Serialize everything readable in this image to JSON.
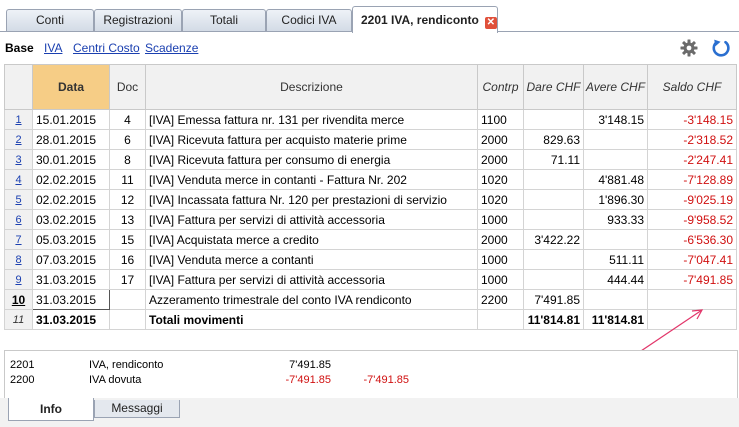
{
  "tabs": [
    {
      "label": "Conti"
    },
    {
      "label": "Registrazioni"
    },
    {
      "label": "Totali"
    },
    {
      "label": "Codici IVA"
    },
    {
      "label": "2201 IVA, rendiconto"
    }
  ],
  "views": [
    "Base",
    "IVA",
    "Centri Costo",
    "Scadenze"
  ],
  "columns": [
    "Data",
    "Doc",
    "Descrizione",
    "Contrp",
    "Dare CHF",
    "Avere CHF",
    "Saldo CHF"
  ],
  "rows": [
    {
      "n": "1",
      "date": "15.01.2015",
      "doc": "4",
      "desc": "[IVA] Emessa fattura nr. 131 per rivendita merce",
      "contrp": "1100",
      "dare": "",
      "avere": "3'148.15",
      "saldo": "-3'148.15"
    },
    {
      "n": "2",
      "date": "28.01.2015",
      "doc": "6",
      "desc": "[IVA] Ricevuta fattura per acquisto materie prime",
      "contrp": "2000",
      "dare": "829.63",
      "avere": "",
      "saldo": "-2'318.52"
    },
    {
      "n": "3",
      "date": "30.01.2015",
      "doc": "8",
      "desc": "[IVA] Ricevuta fattura per consumo di energia",
      "contrp": "2000",
      "dare": "71.11",
      "avere": "",
      "saldo": "-2'247.41"
    },
    {
      "n": "4",
      "date": "02.02.2015",
      "doc": "11",
      "desc": "[IVA] Venduta merce in contanti - Fattura Nr. 202",
      "contrp": "1020",
      "dare": "",
      "avere": "4'881.48",
      "saldo": "-7'128.89"
    },
    {
      "n": "5",
      "date": "02.02.2015",
      "doc": "12",
      "desc": "[IVA] Incassata fattura Nr. 120 per prestazioni di servizio",
      "contrp": "1020",
      "dare": "",
      "avere": "1'896.30",
      "saldo": "-9'025.19"
    },
    {
      "n": "6",
      "date": "03.02.2015",
      "doc": "13",
      "desc": "[IVA] Fattura per servizi di attività accessoria",
      "contrp": "1000",
      "dare": "",
      "avere": "933.33",
      "saldo": "-9'958.52"
    },
    {
      "n": "7",
      "date": "05.03.2015",
      "doc": "15",
      "desc": "[IVA] Acquistata merce a credito",
      "contrp": "2000",
      "dare": "3'422.22",
      "avere": "",
      "saldo": "-6'536.30"
    },
    {
      "n": "8",
      "date": "07.03.2015",
      "doc": "16",
      "desc": "[IVA] Venduta merce a contanti",
      "contrp": "1000",
      "dare": "",
      "avere": "511.11",
      "saldo": "-7'047.41"
    },
    {
      "n": "9",
      "date": "31.03.2015",
      "doc": "17",
      "desc": "[IVA] Fattura per servizi di attività accessoria",
      "contrp": "1000",
      "dare": "",
      "avere": "444.44",
      "saldo": "-7'491.85"
    },
    {
      "n": "10",
      "date": "31.03.2015",
      "doc": "",
      "desc": "Azzeramento trimestrale del conto IVA rendiconto",
      "contrp": "2200",
      "dare": "7'491.85",
      "avere": "",
      "saldo": ""
    },
    {
      "n": "11",
      "date": "31.03.2015",
      "doc": "",
      "desc": "Totali movimenti",
      "contrp": "",
      "dare": "11'814.81",
      "avere": "11'814.81",
      "saldo": ""
    }
  ],
  "info": [
    {
      "account": "2201",
      "name": "IVA, rendiconto",
      "v1": "7'491.85",
      "v2": ""
    },
    {
      "account": "2200",
      "name": "IVA dovuta",
      "v1": "-7'491.85",
      "v2": "-7'491.85"
    }
  ],
  "bottom_tabs": [
    "Info",
    "Messaggi"
  ],
  "colors": {
    "negative": "#d01010",
    "date_header": "#f6cd86",
    "link": "#1a3fb0",
    "close": "#e0503a",
    "refresh": "#2a6fd0",
    "arrow": "#e2366a"
  },
  "icons": {
    "close": "close-icon",
    "gear": "gear-icon",
    "refresh": "refresh-icon"
  }
}
